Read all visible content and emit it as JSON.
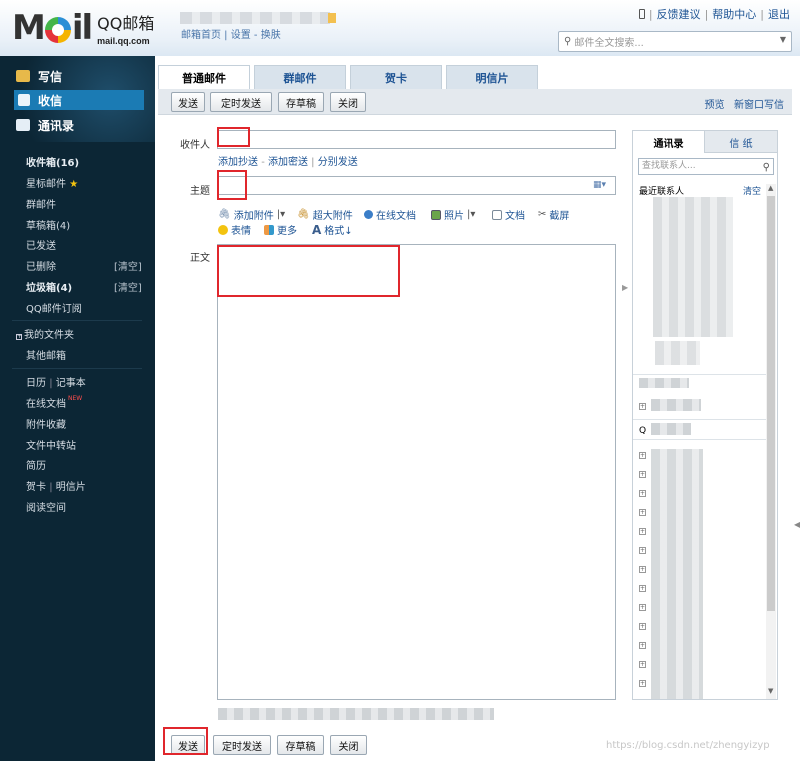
{
  "header": {
    "logo_brand": "QQ邮箱",
    "logo_domain": "mail.qq.com",
    "logo_text": "Mail",
    "home_links": "邮箱首页 | 设置 - 换肤",
    "top_links": [
      "反馈建议",
      "帮助中心",
      "退出"
    ],
    "search_placeholder": "邮件全文搜索..."
  },
  "sidebar": {
    "compose": "写信",
    "inbox": "收信",
    "contacts": "通讯录",
    "folders": [
      {
        "label": "收件箱(16)",
        "bold": true
      },
      {
        "label": "星标邮件"
      },
      {
        "label": "群邮件"
      },
      {
        "label": "草稿箱(4)"
      },
      {
        "label": "已发送"
      },
      {
        "label": "已删除",
        "action": "[清空]"
      },
      {
        "label": "垃圾箱(4)",
        "bold": true,
        "action": "[清空]"
      },
      {
        "label": "QQ邮件订阅"
      }
    ],
    "my_folders": "我的文件夹",
    "other_mailbox": "其他邮箱",
    "apps": {
      "calendar": "日历",
      "notes": "记事本",
      "online_docs": "在线文档",
      "new_badge": "NEW",
      "attachments": "附件收藏",
      "file_transfer": "文件中转站",
      "resume": "简历",
      "greeting": "贺卡",
      "postcard": "明信片",
      "reading": "阅读空间"
    }
  },
  "tabs": [
    "普通邮件",
    "群邮件",
    "贺卡",
    "明信片"
  ],
  "toolbar": {
    "send": "发送",
    "scheduled_send": "定时发送",
    "save_draft": "存草稿",
    "close": "关闭",
    "preview": "预览",
    "new_window": "新窗口写信"
  },
  "compose": {
    "recipient_label": "收件人",
    "cc_link": "添加抄送",
    "bcc_link": "添加密送",
    "separate_link": "分别发送",
    "subject_label": "主题",
    "body_label": "正文",
    "tools": {
      "attach": "添加附件",
      "big_attach": "超大附件",
      "online_doc": "在线文档",
      "photo": "照片",
      "doc": "文档",
      "screenshot": "截屏",
      "emoji": "表情",
      "more": "更多",
      "format": "格式↓"
    }
  },
  "right_panel": {
    "tab_contacts": "通讯录",
    "tab_stationery": "信 纸",
    "search_placeholder": "查找联系人...",
    "recent_label": "最近联系人",
    "clear": "清空",
    "q_group_label": "Q"
  },
  "watermark": "https://blog.csdn.net/zhengyizyp",
  "colors": {
    "accent": "#1b7bb4",
    "highlight_box": "#e0262c",
    "sidebar_bg": "#0c2635"
  }
}
